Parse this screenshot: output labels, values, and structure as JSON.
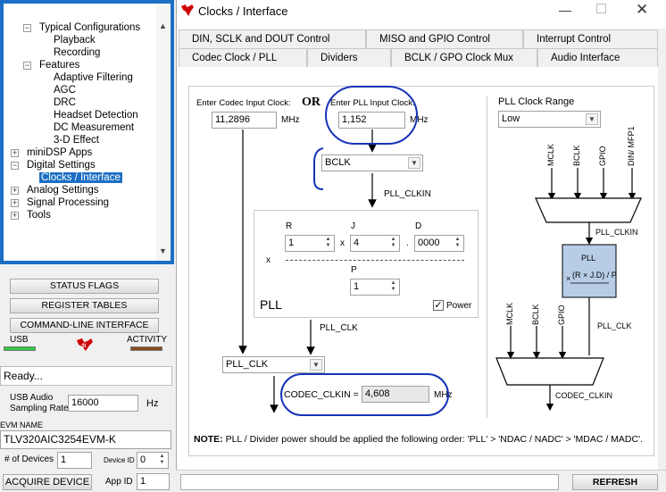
{
  "left": {
    "tree": [
      {
        "label": "Typical Configurations",
        "level": 1,
        "exp": "−"
      },
      {
        "label": "Playback",
        "level": 2
      },
      {
        "label": "Recording",
        "level": 2
      },
      {
        "label": "Features",
        "level": 1,
        "exp": "−"
      },
      {
        "label": "Adaptive Filtering",
        "level": 2
      },
      {
        "label": "AGC",
        "level": 2
      },
      {
        "label": "DRC",
        "level": 2
      },
      {
        "label": "Headset Detection",
        "level": 2
      },
      {
        "label": "DC Measurement",
        "level": 2
      },
      {
        "label": "3-D Effect",
        "level": 2
      },
      {
        "label": "miniDSP Apps",
        "level": 0,
        "exp": "+"
      },
      {
        "label": "Digital Settings",
        "level": 0,
        "exp": "−"
      },
      {
        "label": "Clocks / Interface",
        "level": 1,
        "selected": true
      },
      {
        "label": "Analog Settings",
        "level": 0,
        "exp": "+"
      },
      {
        "label": "Signal Processing",
        "level": 0,
        "exp": "+"
      },
      {
        "label": "Tools",
        "level": 0,
        "exp": "+"
      }
    ],
    "status_flags": "STATUS FLAGS",
    "register_tables": "REGISTER TABLES",
    "command_line": "COMMAND-LINE INTERFACE",
    "usb_label": "USB",
    "activity_label": "ACTIVITY",
    "status_text": "Ready...",
    "usb_rate_label_1": "USB Audio",
    "usb_rate_label_2": "Sampling Rate",
    "usb_rate_value": "16000",
    "usb_rate_unit": "Hz",
    "evm_name_label": "EVM NAME",
    "evm_name_value": "TLV320AIC3254EVM-K",
    "num_devices_label": "# of Devices",
    "num_devices_value": "1",
    "device_id_label": "Device ID",
    "device_id_value": "0",
    "acquire_label": "ACQUIRE DEVICE",
    "app_id_label": "App ID",
    "app_id_value": "1"
  },
  "dialog": {
    "title": "Clocks / Interface",
    "tabs_row1": [
      "DIN, SCLK and DOUT Control",
      "MISO and GPIO Control",
      "Interrupt Control"
    ],
    "tabs_row2": [
      "Codec Clock / PLL",
      "Dividers",
      "BCLK / GPO Clock Mux",
      "Audio Interface"
    ],
    "codec_input_label": "Enter Codec Input Clock:",
    "codec_input_value": "11,2896",
    "mhz": "MHz",
    "or": "OR",
    "pll_input_label": "Enter PLL Input Clock:",
    "pll_input_value": "1,152",
    "pll_src_value": "BCLK",
    "pll_clkin": "PLL_CLKIN",
    "r_label": "R",
    "r_value": "1",
    "j_label": "J",
    "j_value": "4",
    "d_label": "D",
    "d_value": "0000",
    "p_label": "P",
    "p_value": "1",
    "x_sym": "x",
    "dot": ".",
    "pll_label": "PLL",
    "power_label": "Power",
    "pll_clk": "PLL_CLK",
    "codec_src_value": "PLL_CLK",
    "codec_clkin_label": "CODEC_CLKIN =",
    "codec_clkin_value": "4,608",
    "mhz_short": "MHz",
    "range_label": "PLL Range",
    "range_value": "Low",
    "range_legend": "PLL Clock Range",
    "diag_top_inputs": [
      "MCLK",
      "BCLK",
      "GPIO",
      "DIN/ MFP1"
    ],
    "diag_pll_clkin": "PLL_CLKIN",
    "diag_pll": "PLL",
    "diag_formula": "(R × J.D) / P",
    "diag_x": "×",
    "diag_bottom_inputs": [
      "MCLK",
      "BCLK",
      "GPIO"
    ],
    "diag_pll_clk": "PLL_CLK",
    "diag_codec_clkin": "CODEC_CLKIN",
    "note_bold": "NOTE:",
    "note_text": " PLL / Divider power should be applied the following order: 'PLL' > 'NDAC / NADC' > 'MDAC / MADC'.",
    "refresh": "REFRESH"
  },
  "colors": {
    "accent": "#1c6fc4",
    "ink": "#1733b8",
    "pll_box": "#b7cde6",
    "ti_red": "#cc0000"
  }
}
